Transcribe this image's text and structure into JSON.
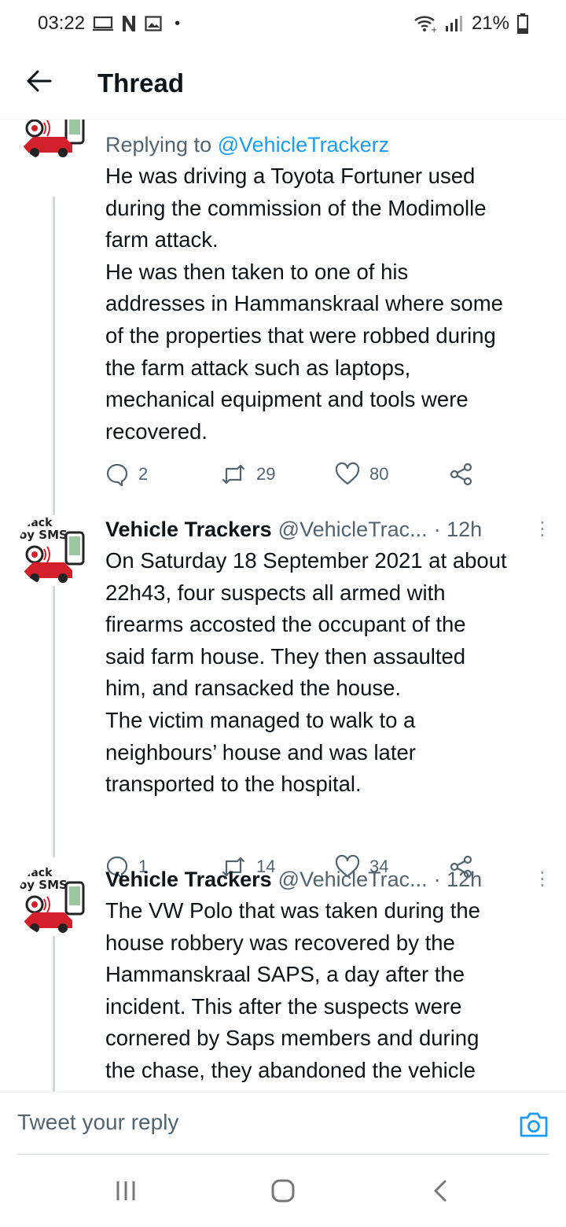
{
  "status_bar": {
    "time": "03:22",
    "battery": "21%",
    "icons": [
      "screen-icon",
      "netflix-n-icon",
      "gallery-icon",
      "dot-icon",
      "wifi-icon",
      "signal-icon",
      "battery-icon"
    ]
  },
  "header": {
    "back_icon": "arrow-left-icon",
    "title": "Thread"
  },
  "tweets": [
    {
      "reply_label": "Replying to",
      "reply_handle": "@VehicleTrackerz",
      "text": "He was driving a Toyota Fortuner used\nduring the commission of the Modimolle\nfarm attack.\nHe was then taken to one of his\naddresses in Hammanskraal where some\nof the properties that were robbed during\nthe farm attack such as laptops,\nmechanical equipment and tools were\nrecovered.",
      "replies": "2",
      "retweets": "29",
      "likes": "80"
    },
    {
      "name": "Vehicle Trackers",
      "handle": "@VehicleTrac...",
      "time": "· 12h",
      "more": "⋮",
      "text": "On Saturday 18 September 2021 at about\n22h43, four suspects all armed with\nfirearms accosted the occupant of the\nsaid farm house. They then assaulted\nhim, and ransacked the house.\nThe victim managed to walk to a\nneighbours’ house and was later\ntransported to the hospital.",
      "replies": "1",
      "retweets": "14",
      "likes": "34"
    },
    {
      "name": "Vehicle Trackers",
      "handle": "@VehicleTrac...",
      "time": "· 12h",
      "more": "⋮",
      "text": "The VW Polo that was taken during the\nhouse robbery was recovered by the\nHammanskraal SAPS, a day after the\nincident. This after the suspects were\ncornered by Saps members and during\nthe chase, they abandoned the vehicle"
    }
  ],
  "avatar": {
    "line1": ".ack",
    "line2": "oy SMS"
  },
  "reply_bar": {
    "placeholder": "Tweet your reply",
    "camera_icon": "camera-icon"
  },
  "nav_bar": {
    "icons": [
      "recents-icon",
      "home-icon",
      "back-icon"
    ]
  },
  "colors": {
    "accent": "#1d9bf0",
    "secondary_text": "#536471",
    "text": "#0f1419",
    "thread_line": "#cfd9de",
    "avatar_car": "#d4202a"
  }
}
